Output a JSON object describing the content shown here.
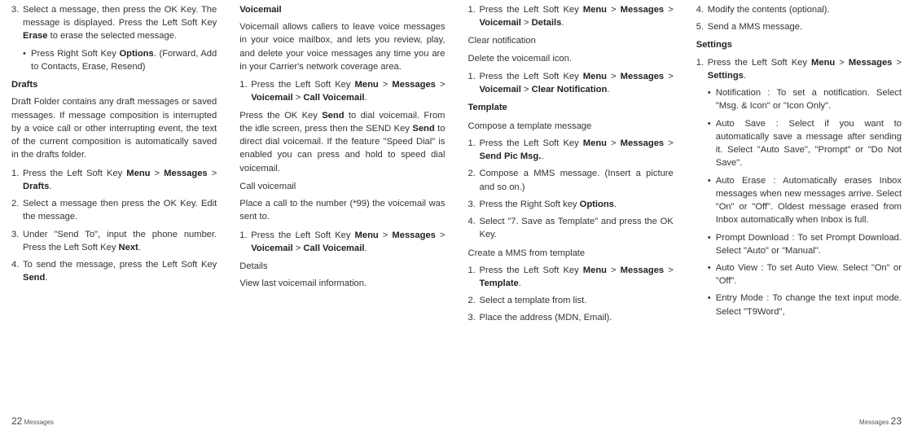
{
  "col1": {
    "i1_num": "3.",
    "i1_b1": "Select a message, then press the OK Key. The message is displayed. Press the Left Soft Key ",
    "i1_erase": "Erase",
    "i1_b2": " to erase the selected message.",
    "i1s_b1": "Press Right Soft Key ",
    "i1s_options": "Options",
    "i1s_b2": ". (Forward, Add to Contacts, Erase, Resend)",
    "h_drafts": "Drafts",
    "p_drafts": "Draft Folder contains any draft messages or saved messages. If message composition is interrupted by a voice call or other interrupting event, the text of the current composition is automatically saved in the drafts folder.",
    "d1_num": "1.",
    "d1_b1": "Press the Left Soft Key ",
    "d1_menu": "Menu",
    "d1_gt1": " > ",
    "d1_msgs": "Messages",
    "d1_gt2": " > ",
    "d1_drafts": "Drafts",
    "d1_dot": ".",
    "d2_num": "2.",
    "d2_b": "Select a message then press the OK Key. Edit the message.",
    "d3_num": "3.",
    "d3_b1": "Under \"Send To\", input the phone number. Press the Left Soft Key ",
    "d3_next": "Next",
    "d3_dot": ".",
    "d4_num": "4.",
    "d4_b1": "To send the message, press the Left Soft Key ",
    "d4_send": "Send",
    "d4_dot": ".",
    "footer_num": "22",
    "footer_label": "Messages"
  },
  "col2": {
    "h_vm": "Voicemail",
    "p_vm": "Voicemail allows callers to leave voice messages in your voice mailbox, and lets you review, play, and delete your voice messages any time you are in your Carrier's network coverage area.",
    "v1_num": "1.",
    "v1_b1": "Press the Left Soft Key ",
    "v1_menu": "Menu",
    "v1_gt1": " > ",
    "v1_msgs": "Messages",
    "v1_gt2": " > ",
    "v1_vm": "Voicemail",
    "v1_gt3": " > ",
    "v1_call": "Call Voicemail",
    "v1_dot": ".",
    "p_send1": "Press the OK Key ",
    "p_send_b1": "Send",
    "p_send2": " to dial voicemail. From the idle screen, press then the SEND Key ",
    "p_send_b2": "Send",
    "p_send3": " to direct dial voicemail. If the feature \"Speed Dial\" is enabled you can press and hold to speed dial voicemail.",
    "h_callvm": "Call voicemail",
    "p_callvm": "Place a call to the number (*99) the voicemail was sent to.",
    "c1_num": "1.",
    "c1_b1": "Press the Left Soft Key ",
    "c1_menu": "Menu",
    "c1_gt1": " > ",
    "c1_msgs": "Messages",
    "c1_gt2": " > ",
    "c1_vm": "Voicemail",
    "c1_gt3": " > ",
    "c1_call": "Call Voicemail",
    "c1_dot": ".",
    "h_details": "Details",
    "p_details": "View last voicemail information."
  },
  "col3": {
    "a1_num": "1.",
    "a1_b1": "Press the Left Soft Key ",
    "a1_menu": "Menu",
    "a1_gt1": " > ",
    "a1_msgs": "Messages",
    "a1_gt2": " > ",
    "a1_vm": "Voicemail",
    "a1_gt3": " > ",
    "a1_det": "Details",
    "a1_dot": ".",
    "h_clear": "Clear notification",
    "p_clear": "Delete the voicemail icon.",
    "b1_num": "1.",
    "b1_b1": "Press the Left Soft Key ",
    "b1_menu": "Menu",
    "b1_gt1": " > ",
    "b1_msgs": "Messages",
    "b1_gt2": " > ",
    "b1_vm": "Voicemail",
    "b1_gt3": " > ",
    "b1_cn": "Clear Notification",
    "b1_dot": ".",
    "h_tmpl": "Template",
    "h_compose": "Compose a template message",
    "t1_num": "1.",
    "t1_b1": "Press the Left Soft Key ",
    "t1_menu": "Menu",
    "t1_gt1": " > ",
    "t1_msgs": "Messages",
    "t1_gt2": " > ",
    "t1_spm": "Send Pic Msg.",
    "t1_dot": ".",
    "t2_num": "2.",
    "t2_b": "Compose a MMS message. (Insert a picture and so on.)",
    "t3_num": "3.",
    "t3_b1": "Press the Right Soft key ",
    "t3_opt": "Options",
    "t3_dot": ".",
    "t4_num": "4.",
    "t4_b": "Select \"7. Save as Template\" and press the OK Key.",
    "h_create": "Create a MMS from template",
    "m1_num": "1.",
    "m1_b1": "Press the Left Soft Key ",
    "m1_menu": "Menu",
    "m1_gt1": " > ",
    "m1_msgs": "Messages",
    "m1_gt2": " > ",
    "m1_tmpl": "Template",
    "m1_dot": ".",
    "m2_num": "2.",
    "m2_b": "Select a template from list.",
    "m3_num": "3.",
    "m3_b": "Place the address (MDN, Email)."
  },
  "col4": {
    "n4_num": "4.",
    "n4_b": "Modify the contents (optional).",
    "n5_num": "5.",
    "n5_b": "Send a MMS message.",
    "h_settings": "Settings",
    "s1_num": "1.",
    "s1_b1": "Press the Left Soft Key ",
    "s1_menu": "Menu",
    "s1_gt1": " > ",
    "s1_msgs": "Messages",
    "s1_gt2": " > ",
    "s1_set": "Settings",
    "s1_dot": ".",
    "bl1": "Notification : To set a notification. Select \"Msg. & Icon\" or \"Icon Only\".",
    "bl2": "Auto Save : Select if you want to automatically save a message after sending it. Select \"Auto Save\", \"Prompt\" or \"Do Not Save\".",
    "bl3": "Auto Erase : Automatically erases Inbox messages when new messages arrive. Select \"On\" or \"Off\". Oldest message erased from Inbox automatically when Inbox is full.",
    "bl4": "Prompt Download : To set Prompt Download. Select \"Auto\" or \"Manual\".",
    "bl5": "Auto View : To set Auto View. Select \"On\" or \"Off\".",
    "bl6": "Entry Mode : To change the text input mode. Select \"T9Word\",",
    "footer_label": "Messages",
    "footer_num": "23"
  }
}
